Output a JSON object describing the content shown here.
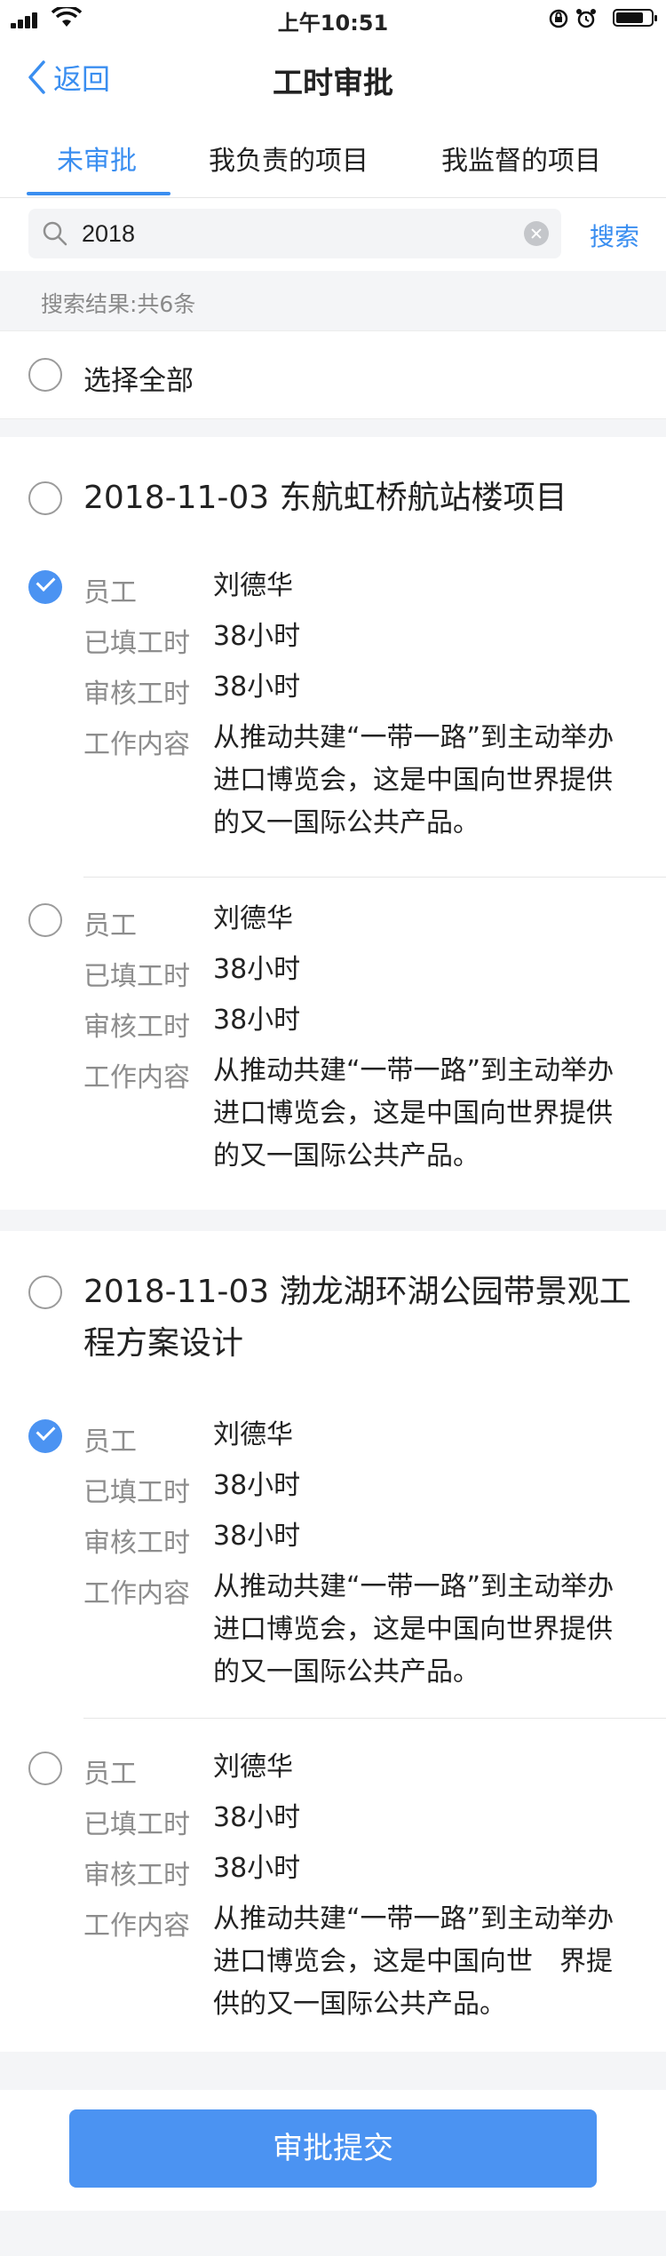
{
  "status_bar": {
    "time": "上午10:51"
  },
  "nav": {
    "back_label": "返回",
    "title": "工时审批"
  },
  "tabs": [
    {
      "label": "未审批",
      "active": true
    },
    {
      "label": "我负责的项目",
      "active": false
    },
    {
      "label": "我监督的项目",
      "active": false
    }
  ],
  "search": {
    "value": "2018",
    "placeholder": "",
    "button_label": "搜索"
  },
  "result_info": "搜索结果:共6条",
  "select_all_label": "选择全部",
  "field_labels": {
    "employee": "员工",
    "filled_hours": "已填工时",
    "review_hours": "审核工时",
    "work_content": "工作内容"
  },
  "groups": [
    {
      "title": "2018-11-03 东航虹桥航站楼项目",
      "checked": false,
      "entries": [
        {
          "checked": true,
          "employee": "刘德华",
          "filled_hours": "38小时",
          "review_hours": "38小时",
          "content_lines": [
            "从推动共建“一带一路”到主动举办",
            "进口博览会，这是中国向世界提供",
            "的又一国际公共产品。"
          ]
        },
        {
          "checked": false,
          "employee": "刘德华",
          "filled_hours": "38小时",
          "review_hours": "38小时",
          "content_lines": [
            "从推动共建“一带一路”到主动举办",
            "进口博览会，这是中国向世界提供",
            "的又一国际公共产品。"
          ]
        }
      ]
    },
    {
      "title_lines": [
        "2018-11-03 渤龙湖环湖公园带景观工",
        "程方案设计"
      ],
      "checked": false,
      "entries": [
        {
          "checked": true,
          "employee": "刘德华",
          "filled_hours": "38小时",
          "review_hours": "38小时",
          "content_lines": [
            "从推动共建“一带一路”到主动举办",
            "进口博览会，这是中国向世界提供",
            "的又一国际公共产品。"
          ]
        },
        {
          "checked": false,
          "employee": "刘德华",
          "filled_hours": "38小时",
          "review_hours": "38小时",
          "content_lines": [
            "从推动共建“一带一路”到主动举办",
            "进口博览会，这是中国向世　界提",
            "供的又一国际公共产品。"
          ]
        }
      ]
    }
  ],
  "submit_label": "审批提交",
  "colors": {
    "accent": "#3a8ef0",
    "button": "#4b93f2",
    "background": "#f4f5f7"
  }
}
